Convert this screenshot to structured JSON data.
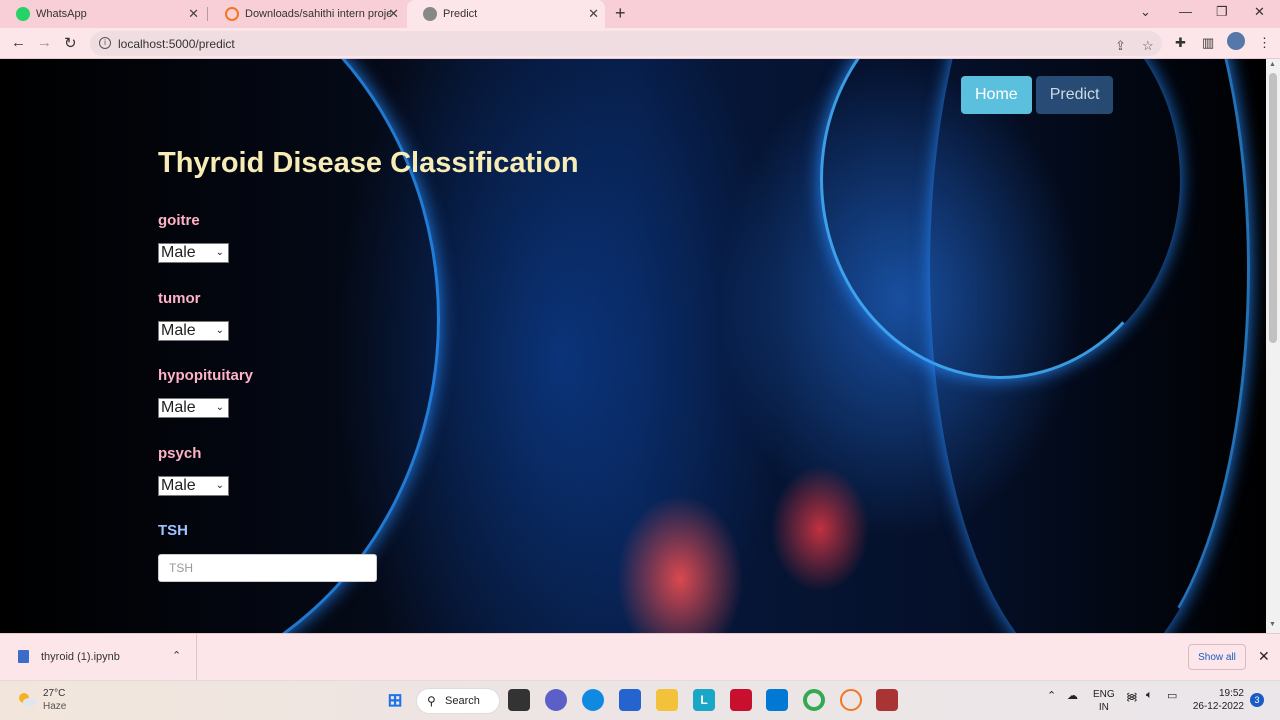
{
  "browser": {
    "tabs": [
      {
        "title": "WhatsApp",
        "icon": "whatsapp-icon"
      },
      {
        "title": "Downloads/sahithi intern project",
        "icon": "jupyter-icon"
      },
      {
        "title": "Predict",
        "icon": "globe-icon"
      }
    ],
    "url": "localhost:5000/predict"
  },
  "nav": {
    "home_label": "Home",
    "predict_label": "Predict"
  },
  "form": {
    "title": "Thyroid Disease Classification",
    "fields": [
      {
        "label": "goitre",
        "value": "Male"
      },
      {
        "label": "tumor",
        "value": "Male"
      },
      {
        "label": "hypopituitary",
        "value": "Male"
      },
      {
        "label": "psych",
        "value": "Male"
      }
    ],
    "tsh_label": "TSH",
    "tsh_placeholder": "TSH"
  },
  "downloads": {
    "file_name": "thyroid (1).ipynb",
    "show_all_label": "Show all"
  },
  "taskbar": {
    "weather_temp": "27°C",
    "weather_cond": "Haze",
    "search_label": "Search",
    "lang_top": "ENG",
    "lang_bottom": "IN",
    "time": "19:52",
    "date": "26-12-2022",
    "notification_count": "3"
  },
  "colors": {
    "accent_home": "#5bc0de",
    "title": "#f7ecb5",
    "label": "#ffb3c6",
    "tsh_label": "#9fc3ff"
  }
}
